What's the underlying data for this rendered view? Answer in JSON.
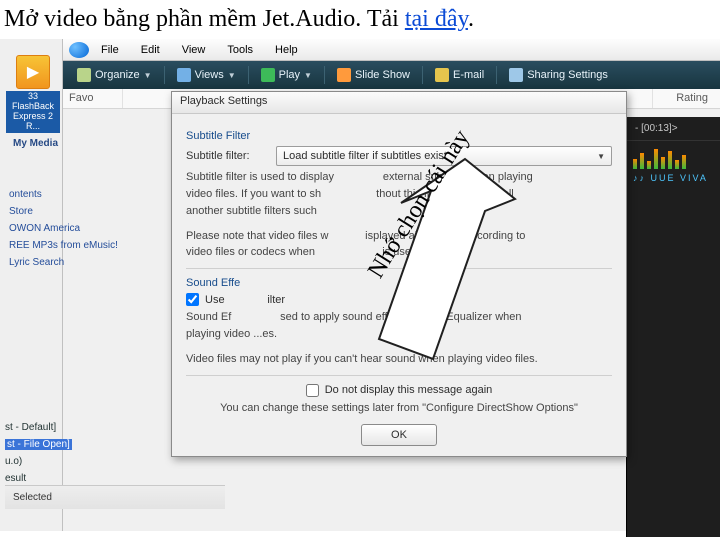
{
  "headline": {
    "prefix": "Mở video bằng phần mềm Jet.Audio. Tải ",
    "link": "tại đây",
    "suffix": "."
  },
  "desktop_icon": {
    "glyph": "▶",
    "label": "33 FlashBack Express 2 R..."
  },
  "menubar": {
    "items": [
      "File",
      "Edit",
      "View",
      "Tools",
      "Help"
    ]
  },
  "cmdbar": {
    "organize": "Organize",
    "views": "Views",
    "play": "Play",
    "slideshow": "Slide Show",
    "email": "E-mail",
    "sharing": "Sharing Settings"
  },
  "columns": {
    "fav": "Favo",
    "rating": "Rating"
  },
  "player": {
    "track": "- [00:13]>",
    "eq_label": "♪♪ UUE VIVA"
  },
  "sidebar": {
    "media_header": "My Media",
    "group1": [
      "ontents",
      "Store",
      "OWON America",
      "REE MP3s from eMusic!",
      "Lyric Search"
    ]
  },
  "fileopen": {
    "row1": "st - Default]",
    "row2": "st - File Open]",
    "row3": "u.o)",
    "row4": "esult",
    "selected": "Selected"
  },
  "dialog": {
    "title": "Playback Settings",
    "sec_filter": "Subtitle Filter",
    "filter_label": "Subtitle filter:",
    "filter_value": "Load subtitle filter if subtitles exist",
    "filter_hint1": "Subtitle filter is used to display",
    "filter_hint1b": "external subtitles when playing",
    "filter_hint2": "video files. If you want to sh",
    "filter_hint2b": "thout this filter, please install",
    "filter_hint3": "another subtitle filters such",
    "filter_note1": "Please note that video files w",
    "filter_note1b": "isplayed abnormally according to",
    "filter_note2": "video files or codecs when",
    "filter_note2b": "is used.",
    "sec_sound": "Sound Effe",
    "use_label": "Use",
    "use_label2": "ilter",
    "sound_hint1": "Sound Ef",
    "sound_hint1b": "sed to apply sound effect such as Equalizer when",
    "sound_hint2": "playing video ...es.",
    "video_hint": "Video files may not play if you can't hear sound when playing video files.",
    "dont_display": "Do not display this message again",
    "change_note": "You can change these settings later from \"Configure DirectShow Options\"",
    "ok": "OK"
  },
  "annotation": {
    "text": "Nhớ chọn cái này"
  }
}
